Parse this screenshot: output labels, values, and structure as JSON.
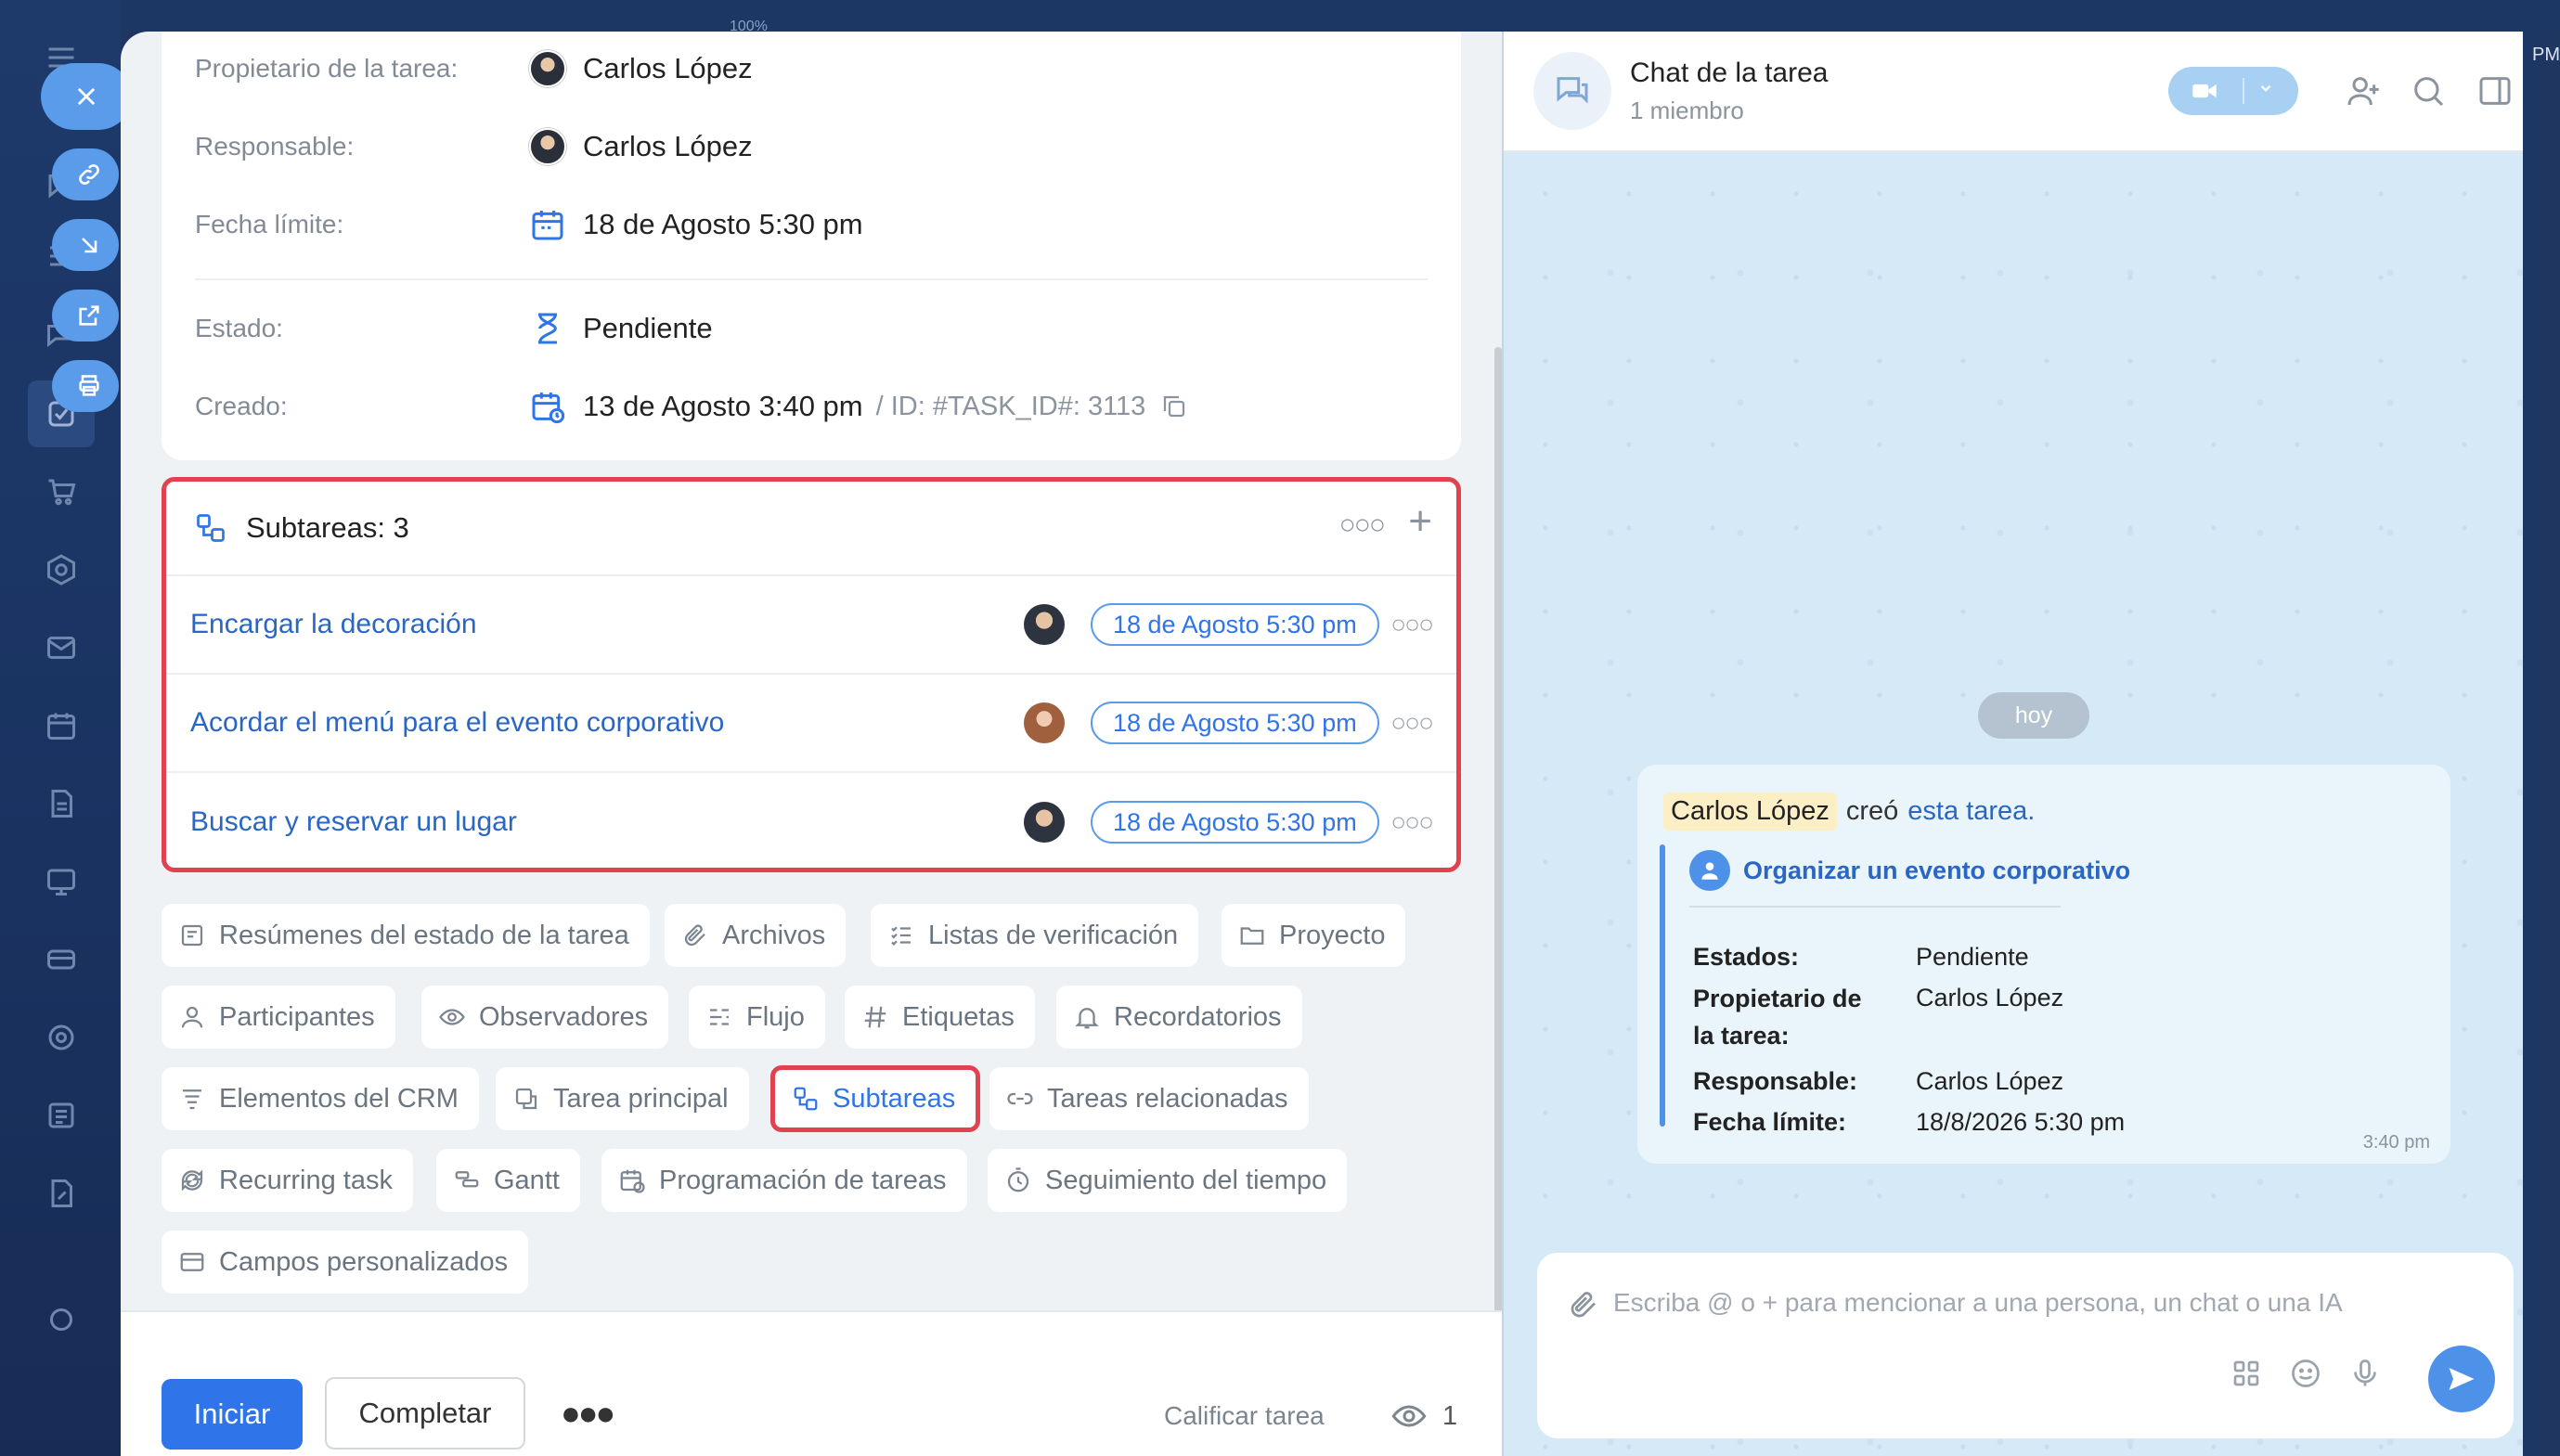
{
  "window": {
    "zoom_label": "100%",
    "corner_label": "PM"
  },
  "details": {
    "owner_label": "Propietario de la tarea:",
    "owner_name": "Carlos López",
    "responsible_label": "Responsable:",
    "responsible_name": "Carlos López",
    "deadline_label": "Fecha límite:",
    "deadline_value": "18 de Agosto 5:30 pm",
    "status_label": "Estado:",
    "status_value": "Pendiente",
    "created_label": "Creado:",
    "created_value": "13 de Agosto 3:40 pm",
    "id_text": "/  ID: #TASK_ID#: 3113"
  },
  "subtasks": {
    "header": "Subtareas: 3",
    "items": [
      {
        "title": "Encargar la decoración",
        "date": "18 de Agosto 5:30 pm"
      },
      {
        "title": "Acordar el menú para el evento corporativo",
        "date": "18 de Agosto 5:30 pm"
      },
      {
        "title": "Buscar y reservar un lugar",
        "date": "18 de Agosto 5:30 pm"
      }
    ]
  },
  "chips": {
    "summaries": "Resúmenes del estado de la tarea",
    "files": "Archivos",
    "checklists": "Listas de verificación",
    "project": "Proyecto",
    "participants": "Participantes",
    "observers": "Observadores",
    "flow": "Flujo",
    "tags": "Etiquetas",
    "reminders": "Recordatorios",
    "crm": "Elementos del CRM",
    "parent": "Tarea principal",
    "subtasks": "Subtareas",
    "related": "Tareas relacionadas",
    "recurring": "Recurring task",
    "gantt": "Gantt",
    "scheduling": "Programación de tareas",
    "time_tracking": "Seguimiento del tiempo",
    "custom_fields": "Campos personalizados"
  },
  "footer": {
    "start": "Iniciar",
    "complete": "Completar",
    "more": "●●●",
    "rate": "Calificar tarea",
    "watchers_count": "1"
  },
  "chat": {
    "title": "Chat de la tarea",
    "subtitle": "1 miembro",
    "day": "hoy",
    "message": {
      "author": "Carlos López",
      "verb": "creó",
      "link": "esta tarea.",
      "task_title": "Organizar un evento corporativo",
      "fields": [
        {
          "k": "Estados:",
          "v": "Pendiente"
        },
        {
          "k": "Propietario de la tarea:",
          "v": "Carlos López"
        },
        {
          "k": "Responsable:",
          "v": "Carlos López"
        },
        {
          "k": "Fecha límite:",
          "v": "18/8/2026 5:30 pm"
        }
      ],
      "time": "3:40 pm"
    },
    "composer_placeholder": "Escriba @ o + para mencionar a una persona, un chat o una IA"
  },
  "colors": {
    "accent": "#2f74e8",
    "highlight": "#e0434f",
    "chat_bg": "#d6e9f6",
    "rail": "#1d3a6b"
  }
}
